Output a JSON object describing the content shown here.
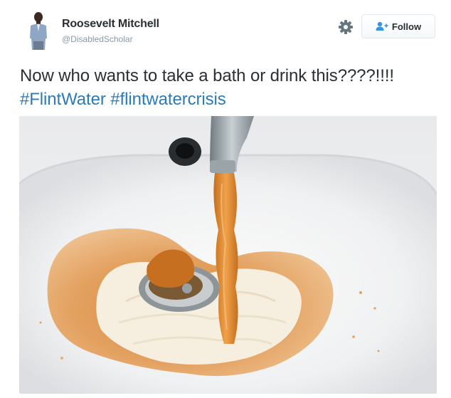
{
  "tweet": {
    "author": {
      "name": "Roosevelt Mitchell",
      "handle": "@DisabledScholar"
    },
    "actions": {
      "settings_icon": "gear-icon",
      "follow_label": "Follow",
      "follow_icon": "add-user-icon"
    },
    "text": {
      "body": "Now who wants to take a bath or drink this????!!!! ",
      "hashtags": [
        "#FlintWater",
        "#flintwatercrisis"
      ]
    },
    "colors": {
      "hashtag": "#2b7bb9",
      "name": "#292f33",
      "handle": "#8899a6",
      "follow_icon": "#3b94d9"
    }
  }
}
